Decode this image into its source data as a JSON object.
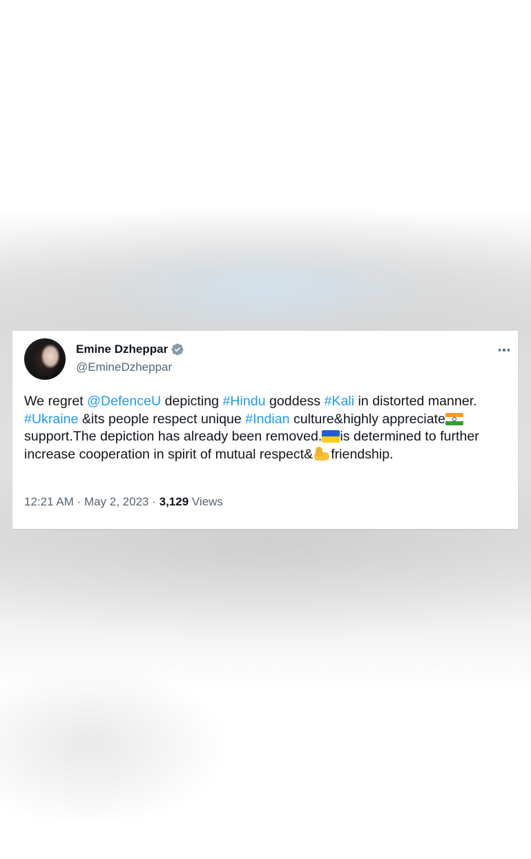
{
  "tweet": {
    "author": {
      "display_name": "Emine Dzheppar",
      "handle": "@EmineDzheppar",
      "verified": true
    },
    "segments": [
      {
        "type": "text",
        "text": "We regret "
      },
      {
        "type": "link",
        "text": "@DefenceU"
      },
      {
        "type": "text",
        "text": " depicting "
      },
      {
        "type": "link",
        "text": "#Hindu"
      },
      {
        "type": "text",
        "text": " goddess "
      },
      {
        "type": "link",
        "text": "#Kali"
      },
      {
        "type": "text",
        "text": " in distorted manner. "
      },
      {
        "type": "link",
        "text": "#Ukraine"
      },
      {
        "type": "text",
        "text": " &its people respect unique "
      },
      {
        "type": "link",
        "text": "#Indian"
      },
      {
        "type": "text",
        "text": " culture&highly appreciate"
      },
      {
        "type": "emoji",
        "name": "india-flag-icon"
      },
      {
        "type": "text",
        "text": "support.The depiction has already been removed."
      },
      {
        "type": "emoji",
        "name": "ukraine-flag-icon"
      },
      {
        "type": "text",
        "text": "is determined to further increase cooperation in spirit of mutual respect&"
      },
      {
        "type": "emoji",
        "name": "flexed-biceps-icon"
      },
      {
        "type": "text",
        "text": "friendship."
      }
    ],
    "time": "12:21 AM",
    "separator": " · ",
    "date": "May 2, 2023",
    "views_count": "3,129",
    "views_label": " Views"
  },
  "colors": {
    "link": "#1d9bf0",
    "text": "#0f1419",
    "secondary": "#536471",
    "verified_badge": "#829aab"
  },
  "icons": {
    "more": "more-options-icon",
    "verified": "verified-badge-icon"
  }
}
